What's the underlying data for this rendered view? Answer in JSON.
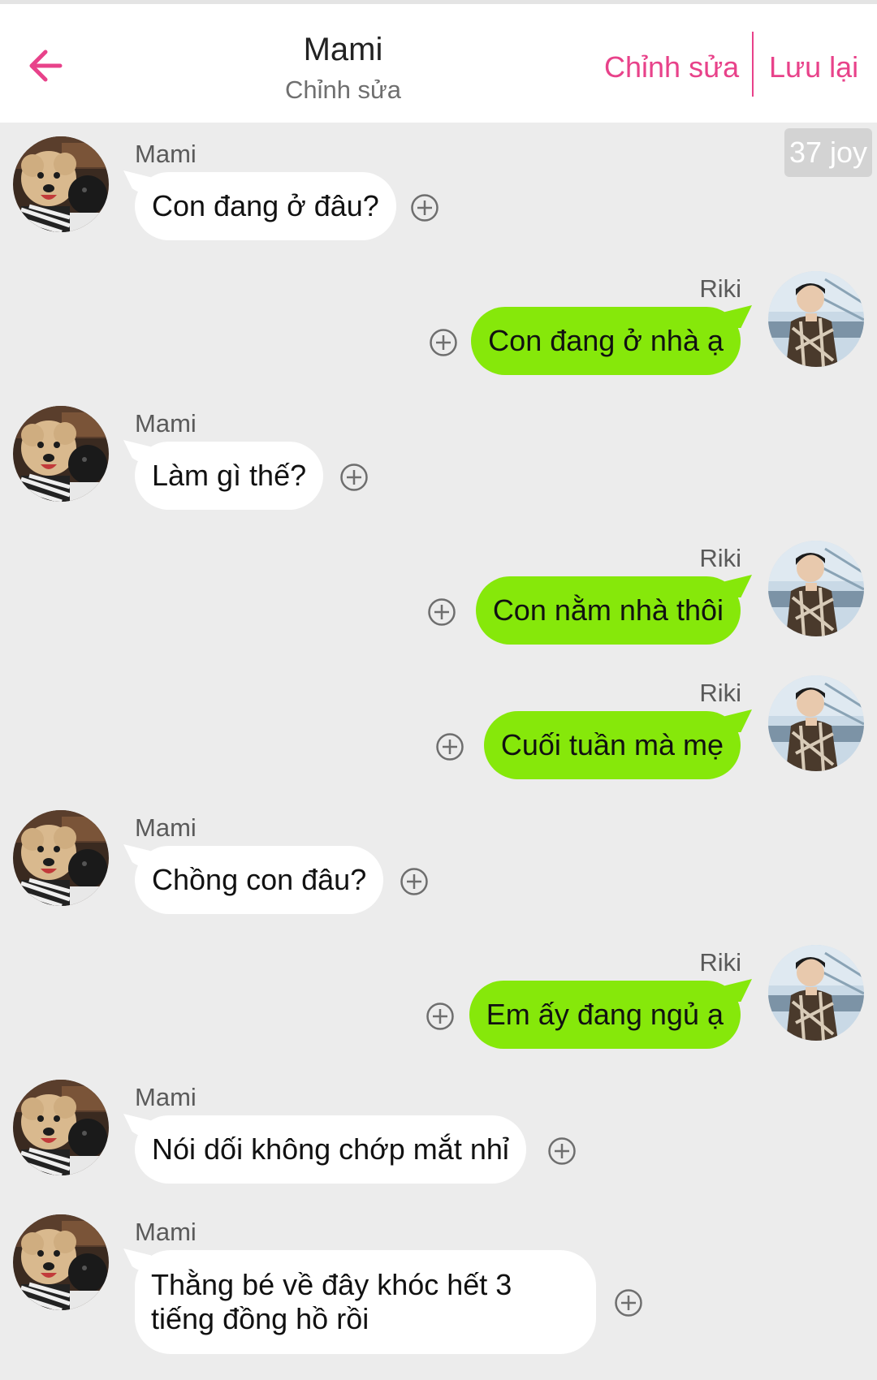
{
  "header": {
    "title": "Mami",
    "subtitle": "Chỉnh sửa",
    "edit_label": "Chỉnh sửa",
    "save_label": "Lưu lại"
  },
  "badge": {
    "label": "37 joy"
  },
  "colors": {
    "accent": "#e8428a",
    "outgoing_bubble": "#86e80a",
    "incoming_bubble": "#ffffff",
    "background": "#ececec"
  },
  "messages": [
    {
      "side": "left",
      "sender": "Mami",
      "text": "Con đang ở đâu?"
    },
    {
      "side": "right",
      "sender": "Riki",
      "text": "Con đang ở nhà ạ"
    },
    {
      "side": "left",
      "sender": "Mami",
      "text": "Làm gì thế?"
    },
    {
      "side": "right",
      "sender": "Riki",
      "text": "Con nằm nhà thôi"
    },
    {
      "side": "right",
      "sender": "Riki",
      "text": "Cuối tuần mà mẹ"
    },
    {
      "side": "left",
      "sender": "Mami",
      "text": "Chồng con đâu?"
    },
    {
      "side": "right",
      "sender": "Riki",
      "text": "Em ấy đang ngủ ạ"
    },
    {
      "side": "left",
      "sender": "Mami",
      "text": "Nói dối không chớp mắt nhỉ"
    },
    {
      "side": "left",
      "sender": "Mami",
      "text": "Thằng bé về đây khóc hết 3 tiếng đồng hồ rồi"
    }
  ],
  "icons": {
    "back": "arrow-left-icon",
    "add_reaction": "plus-circle-icon",
    "mami_avatar": "dog-avatar",
    "riki_avatar": "person-avatar"
  }
}
